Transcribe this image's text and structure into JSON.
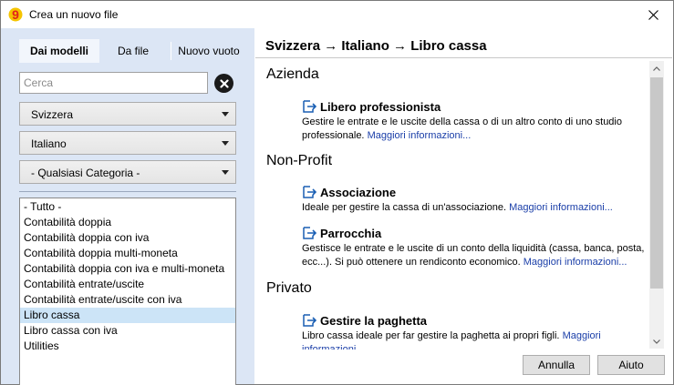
{
  "window": {
    "title": "Crea un nuovo file",
    "app_icon": "banana-logo-icon",
    "close_icon": "close-icon"
  },
  "tabs": [
    {
      "label": "Dai modelli",
      "active": true
    },
    {
      "label": "Da file",
      "active": false
    },
    {
      "label": "Nuovo vuoto",
      "active": false
    }
  ],
  "search": {
    "placeholder": "Cerca",
    "value": "",
    "clear_icon": "clear-circle-x-icon"
  },
  "filters": {
    "country": "Svizzera",
    "language": "Italiano",
    "category": "- Qualsiasi Categoria -"
  },
  "categories": [
    {
      "label": "- Tutto -",
      "selected": false
    },
    {
      "label": "Contabilità doppia",
      "selected": false
    },
    {
      "label": "Contabilità doppia con iva",
      "selected": false
    },
    {
      "label": "Contabilità doppia multi-moneta",
      "selected": false
    },
    {
      "label": "Contabilità doppia con iva e multi-moneta",
      "selected": false
    },
    {
      "label": "Contabilità entrate/uscite",
      "selected": false
    },
    {
      "label": "Contabilità entrate/uscite con iva",
      "selected": false
    },
    {
      "label": "Libro cassa",
      "selected": true
    },
    {
      "label": "Libro cassa con iva",
      "selected": false
    },
    {
      "label": "Utilities",
      "selected": false
    }
  ],
  "content": {
    "header": "Svizzera → Italiano → Libro cassa",
    "more_info_label": "Maggiori informazioni...",
    "sections": [
      {
        "title": "Azienda",
        "entries": [
          {
            "title": "Libero professionista",
            "description": "Gestire le entrate e le uscite della cassa o di un altro conto di uno studio professionale."
          }
        ]
      },
      {
        "title": "Non-Profit",
        "entries": [
          {
            "title": "Associazione",
            "description": "Ideale per gestire la cassa di un'associazione."
          },
          {
            "title": "Parrocchia",
            "description": "Gestisce le entrate e le uscite di un conto della liquidità (cassa, banca, posta, ecc...). Si può ottenere un rendiconto economico."
          }
        ]
      },
      {
        "title": "Privato",
        "entries": [
          {
            "title": "Gestire la paghetta",
            "description": "Libro cassa ideale per far gestire la paghetta ai propri figli."
          }
        ]
      }
    ]
  },
  "buttons": {
    "cancel": "Annulla",
    "help": "Aiuto"
  },
  "icons": {
    "entry_icon": "open-template-arrow-icon",
    "dropdown_icon": "chevron-down-icon",
    "scroll_up_icon": "scroll-up-arrow-icon",
    "scroll_down_icon": "scroll-down-arrow-icon"
  },
  "colors": {
    "left_pane_bg": "#dce6f5",
    "selected_item_bg": "#cce4f7",
    "link": "#1a3ea8",
    "app_icon_red": "#e2231a",
    "app_icon_yellow": "#f5c400"
  }
}
